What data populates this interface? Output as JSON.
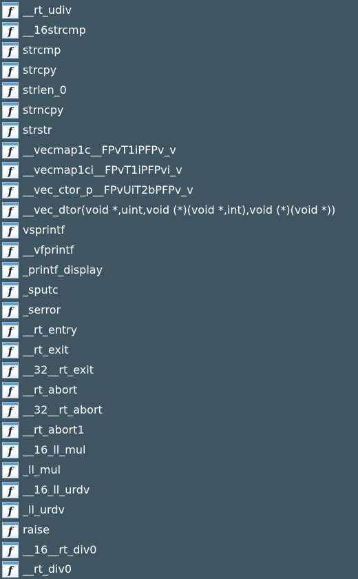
{
  "functions": [
    {
      "name": "__rt_udiv",
      "icon": "function-icon"
    },
    {
      "name": "__16strcmp",
      "icon": "function-icon"
    },
    {
      "name": "strcmp",
      "icon": "function-icon"
    },
    {
      "name": "strcpy",
      "icon": "function-icon"
    },
    {
      "name": "strlen_0",
      "icon": "function-icon"
    },
    {
      "name": "strncpy",
      "icon": "function-icon"
    },
    {
      "name": "strstr",
      "icon": "function-icon"
    },
    {
      "name": "__vecmap1c__FPvT1iPFPv_v",
      "icon": "function-icon"
    },
    {
      "name": "__vecmap1ci__FPvT1iPFPvi_v",
      "icon": "function-icon"
    },
    {
      "name": "__vec_ctor_p__FPvUiT2bPFPv_v",
      "icon": "function-icon"
    },
    {
      "name": "__vec_dtor(void *,uint,void (*)(void *,int),void (*)(void *))",
      "icon": "function-icon"
    },
    {
      "name": "vsprintf",
      "icon": "function-icon"
    },
    {
      "name": "__vfprintf",
      "icon": "function-icon"
    },
    {
      "name": "_printf_display",
      "icon": "function-icon"
    },
    {
      "name": "_sputc",
      "icon": "function-icon"
    },
    {
      "name": "_serror",
      "icon": "function-icon"
    },
    {
      "name": "__rt_entry",
      "icon": "function-icon"
    },
    {
      "name": "__rt_exit",
      "icon": "function-icon"
    },
    {
      "name": "__32__rt_exit",
      "icon": "function-icon"
    },
    {
      "name": "__rt_abort",
      "icon": "function-icon"
    },
    {
      "name": "__32__rt_abort",
      "icon": "function-icon"
    },
    {
      "name": "__rt_abort1",
      "icon": "function-icon"
    },
    {
      "name": "__16_ll_mul",
      "icon": "function-icon"
    },
    {
      "name": "_ll_mul",
      "icon": "function-icon"
    },
    {
      "name": "__16_ll_urdv",
      "icon": "function-icon"
    },
    {
      "name": "_ll_urdv",
      "icon": "function-icon"
    },
    {
      "name": "raise",
      "icon": "function-icon"
    },
    {
      "name": "__16__rt_div0",
      "icon": "function-icon"
    },
    {
      "name": "__rt_div0",
      "icon": "function-icon"
    }
  ],
  "icon_glyph": "f",
  "colors": {
    "background": "#3f5562",
    "text": "#ffffff",
    "icon_bar": "#5e9fd4"
  }
}
